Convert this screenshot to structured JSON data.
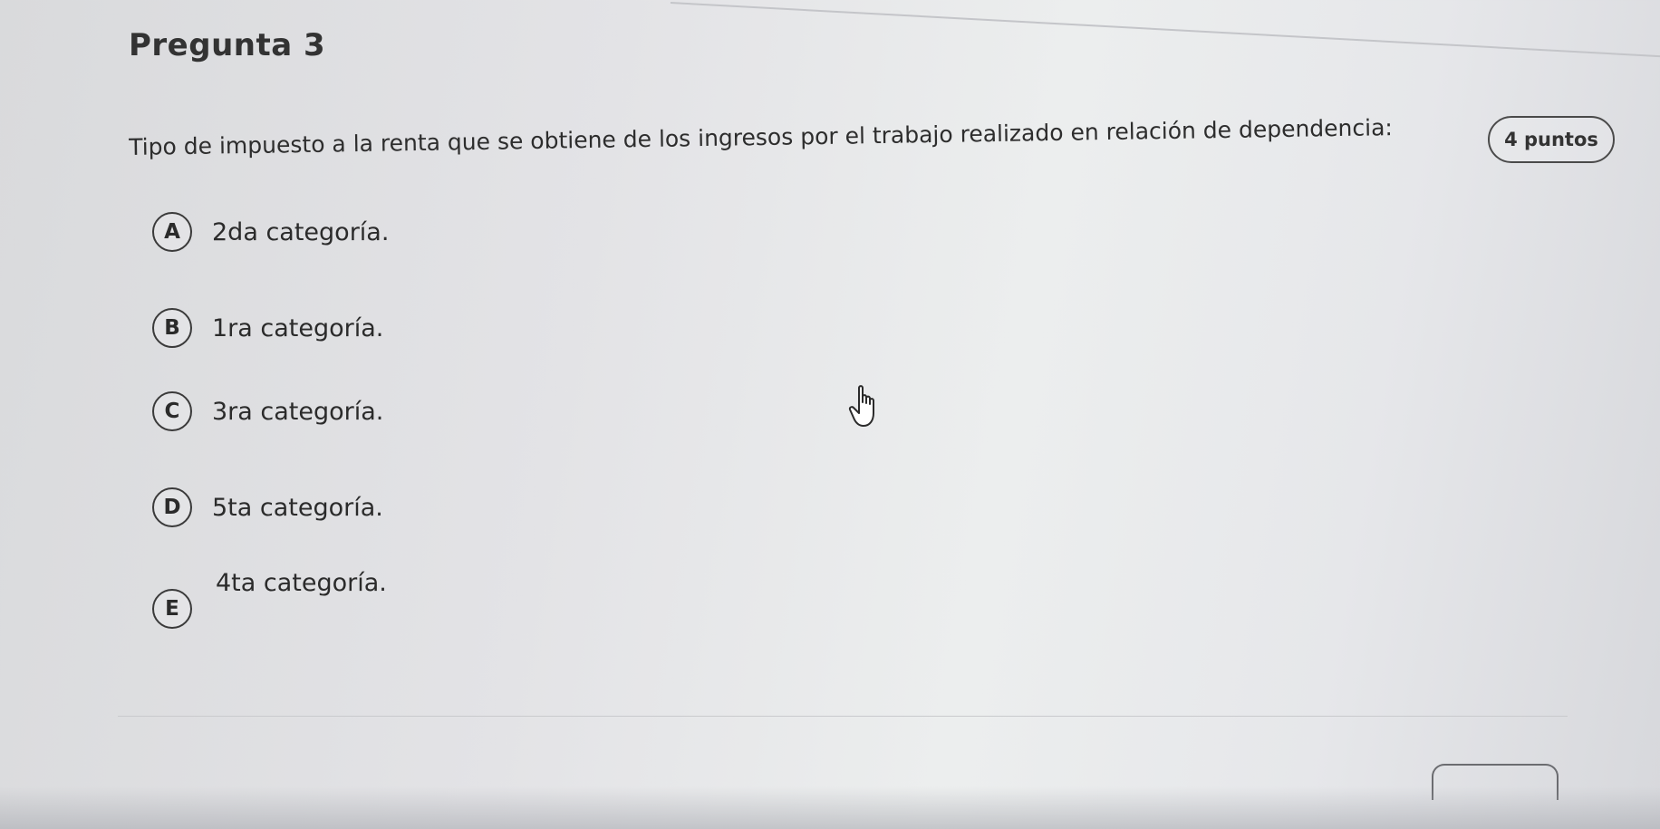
{
  "question": {
    "title": "Pregunta 3",
    "points": "4 puntos",
    "text": "Tipo de impuesto a la renta que se obtiene de los ingresos por el trabajo realizado en relación de dependencia:"
  },
  "options": [
    {
      "letter": "A",
      "label": "2da categoría."
    },
    {
      "letter": "B",
      "label": "1ra categoría."
    },
    {
      "letter": "C",
      "label": "3ra categoría."
    },
    {
      "letter": "D",
      "label": "5ta categoría."
    },
    {
      "letter": "E",
      "label": "4ta categoría."
    }
  ],
  "cursor": {
    "icon": "hand-pointer-icon"
  }
}
